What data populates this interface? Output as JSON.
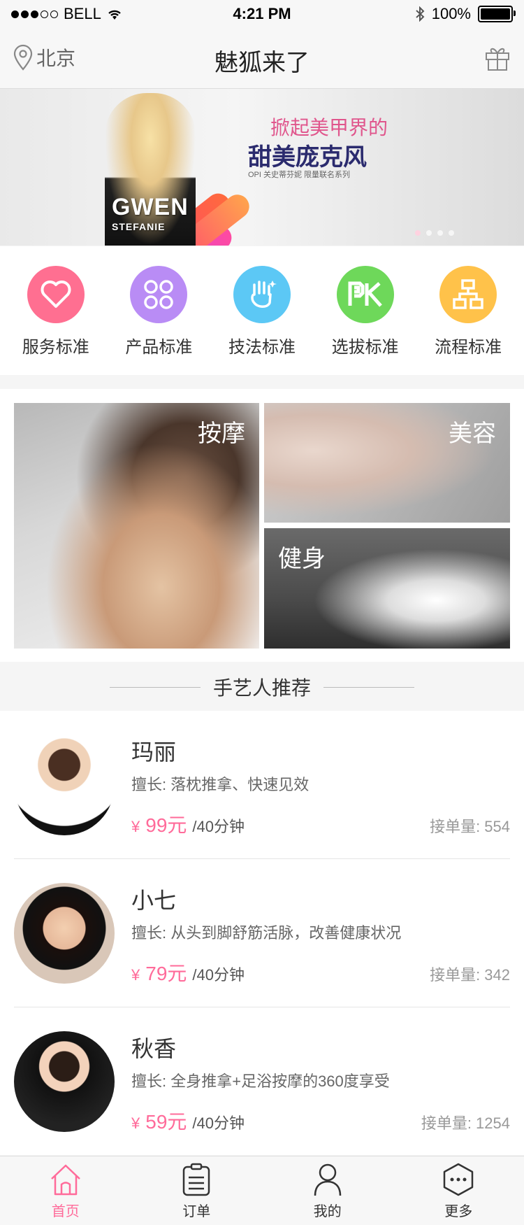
{
  "status_bar": {
    "carrier": "BELL",
    "time": "4:21 PM",
    "battery": "100%"
  },
  "nav": {
    "location": "北京",
    "title": "魅狐来了"
  },
  "banner": {
    "line1": "掀起美甲界的",
    "line2": "甜美庞克风",
    "line3": "OPI 关史蒂芬妮 限量联名系列",
    "brand": "GWEN",
    "brand_sub": "STEFANIE",
    "slides": 4,
    "active_slide": 1
  },
  "categories": [
    {
      "label": "服务标准",
      "icon": "heart-icon",
      "color": "#ff6f91"
    },
    {
      "label": "产品标准",
      "icon": "grid-icon",
      "color": "#b98cf5"
    },
    {
      "label": "技法标准",
      "icon": "hand-icon",
      "color": "#5cc8f5"
    },
    {
      "label": "选拔标准",
      "icon": "pk-icon",
      "color": "#6ed85a"
    },
    {
      "label": "流程标准",
      "icon": "flow-icon",
      "color": "#ffc24a"
    }
  ],
  "features": {
    "massage": "按摩",
    "beauty": "美容",
    "fitness": "健身"
  },
  "section_title": "手艺人推荐",
  "artisans": [
    {
      "name": "玛丽",
      "skill": "擅长: 落枕推拿、快速见效",
      "yen": "¥",
      "price": "99元",
      "unit": "/40分钟",
      "orders": "接单量: 554"
    },
    {
      "name": "小七",
      "skill": "擅长: 从头到脚舒筋活脉，改善健康状况",
      "yen": "¥",
      "price": "79元",
      "unit": "/40分钟",
      "orders": "接单量: 342"
    },
    {
      "name": "秋香",
      "skill": "擅长: 全身推拿+足浴按摩的360度享受",
      "yen": "¥",
      "price": "59元",
      "unit": "/40分钟",
      "orders": "接单量: 1254"
    }
  ],
  "tabs": [
    {
      "label": "首页",
      "icon": "home-icon",
      "active": true
    },
    {
      "label": "订单",
      "icon": "clipboard-icon",
      "active": false
    },
    {
      "label": "我的",
      "icon": "user-icon",
      "active": false
    },
    {
      "label": "更多",
      "icon": "more-icon",
      "active": false
    }
  ],
  "colors": {
    "accent": "#ff6b9a",
    "text": "#333333",
    "muted": "#999999"
  }
}
